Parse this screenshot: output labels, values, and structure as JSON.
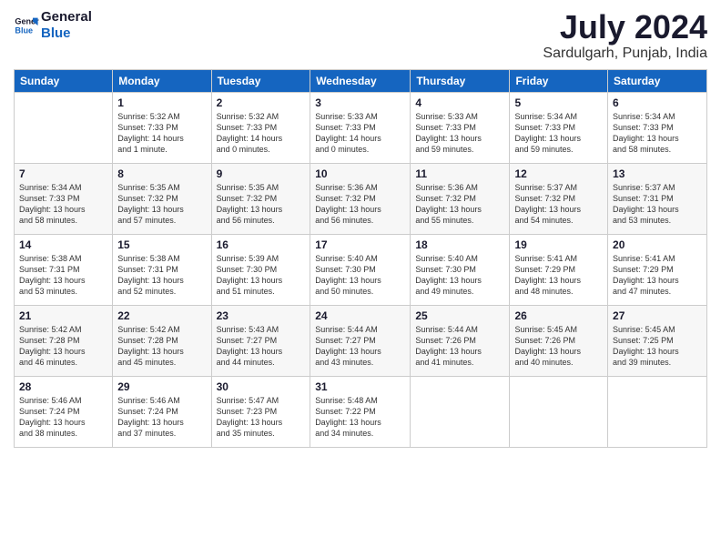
{
  "header": {
    "logo_line1": "General",
    "logo_line2": "Blue",
    "month": "July 2024",
    "location": "Sardulgarh, Punjab, India"
  },
  "columns": [
    "Sunday",
    "Monday",
    "Tuesday",
    "Wednesday",
    "Thursday",
    "Friday",
    "Saturday"
  ],
  "weeks": [
    [
      {
        "day": "",
        "info": ""
      },
      {
        "day": "1",
        "info": "Sunrise: 5:32 AM\nSunset: 7:33 PM\nDaylight: 14 hours\nand 1 minute."
      },
      {
        "day": "2",
        "info": "Sunrise: 5:32 AM\nSunset: 7:33 PM\nDaylight: 14 hours\nand 0 minutes."
      },
      {
        "day": "3",
        "info": "Sunrise: 5:33 AM\nSunset: 7:33 PM\nDaylight: 14 hours\nand 0 minutes."
      },
      {
        "day": "4",
        "info": "Sunrise: 5:33 AM\nSunset: 7:33 PM\nDaylight: 13 hours\nand 59 minutes."
      },
      {
        "day": "5",
        "info": "Sunrise: 5:34 AM\nSunset: 7:33 PM\nDaylight: 13 hours\nand 59 minutes."
      },
      {
        "day": "6",
        "info": "Sunrise: 5:34 AM\nSunset: 7:33 PM\nDaylight: 13 hours\nand 58 minutes."
      }
    ],
    [
      {
        "day": "7",
        "info": "Sunrise: 5:34 AM\nSunset: 7:33 PM\nDaylight: 13 hours\nand 58 minutes."
      },
      {
        "day": "8",
        "info": "Sunrise: 5:35 AM\nSunset: 7:32 PM\nDaylight: 13 hours\nand 57 minutes."
      },
      {
        "day": "9",
        "info": "Sunrise: 5:35 AM\nSunset: 7:32 PM\nDaylight: 13 hours\nand 56 minutes."
      },
      {
        "day": "10",
        "info": "Sunrise: 5:36 AM\nSunset: 7:32 PM\nDaylight: 13 hours\nand 56 minutes."
      },
      {
        "day": "11",
        "info": "Sunrise: 5:36 AM\nSunset: 7:32 PM\nDaylight: 13 hours\nand 55 minutes."
      },
      {
        "day": "12",
        "info": "Sunrise: 5:37 AM\nSunset: 7:32 PM\nDaylight: 13 hours\nand 54 minutes."
      },
      {
        "day": "13",
        "info": "Sunrise: 5:37 AM\nSunset: 7:31 PM\nDaylight: 13 hours\nand 53 minutes."
      }
    ],
    [
      {
        "day": "14",
        "info": "Sunrise: 5:38 AM\nSunset: 7:31 PM\nDaylight: 13 hours\nand 53 minutes."
      },
      {
        "day": "15",
        "info": "Sunrise: 5:38 AM\nSunset: 7:31 PM\nDaylight: 13 hours\nand 52 minutes."
      },
      {
        "day": "16",
        "info": "Sunrise: 5:39 AM\nSunset: 7:30 PM\nDaylight: 13 hours\nand 51 minutes."
      },
      {
        "day": "17",
        "info": "Sunrise: 5:40 AM\nSunset: 7:30 PM\nDaylight: 13 hours\nand 50 minutes."
      },
      {
        "day": "18",
        "info": "Sunrise: 5:40 AM\nSunset: 7:30 PM\nDaylight: 13 hours\nand 49 minutes."
      },
      {
        "day": "19",
        "info": "Sunrise: 5:41 AM\nSunset: 7:29 PM\nDaylight: 13 hours\nand 48 minutes."
      },
      {
        "day": "20",
        "info": "Sunrise: 5:41 AM\nSunset: 7:29 PM\nDaylight: 13 hours\nand 47 minutes."
      }
    ],
    [
      {
        "day": "21",
        "info": "Sunrise: 5:42 AM\nSunset: 7:28 PM\nDaylight: 13 hours\nand 46 minutes."
      },
      {
        "day": "22",
        "info": "Sunrise: 5:42 AM\nSunset: 7:28 PM\nDaylight: 13 hours\nand 45 minutes."
      },
      {
        "day": "23",
        "info": "Sunrise: 5:43 AM\nSunset: 7:27 PM\nDaylight: 13 hours\nand 44 minutes."
      },
      {
        "day": "24",
        "info": "Sunrise: 5:44 AM\nSunset: 7:27 PM\nDaylight: 13 hours\nand 43 minutes."
      },
      {
        "day": "25",
        "info": "Sunrise: 5:44 AM\nSunset: 7:26 PM\nDaylight: 13 hours\nand 41 minutes."
      },
      {
        "day": "26",
        "info": "Sunrise: 5:45 AM\nSunset: 7:26 PM\nDaylight: 13 hours\nand 40 minutes."
      },
      {
        "day": "27",
        "info": "Sunrise: 5:45 AM\nSunset: 7:25 PM\nDaylight: 13 hours\nand 39 minutes."
      }
    ],
    [
      {
        "day": "28",
        "info": "Sunrise: 5:46 AM\nSunset: 7:24 PM\nDaylight: 13 hours\nand 38 minutes."
      },
      {
        "day": "29",
        "info": "Sunrise: 5:46 AM\nSunset: 7:24 PM\nDaylight: 13 hours\nand 37 minutes."
      },
      {
        "day": "30",
        "info": "Sunrise: 5:47 AM\nSunset: 7:23 PM\nDaylight: 13 hours\nand 35 minutes."
      },
      {
        "day": "31",
        "info": "Sunrise: 5:48 AM\nSunset: 7:22 PM\nDaylight: 13 hours\nand 34 minutes."
      },
      {
        "day": "",
        "info": ""
      },
      {
        "day": "",
        "info": ""
      },
      {
        "day": "",
        "info": ""
      }
    ]
  ]
}
